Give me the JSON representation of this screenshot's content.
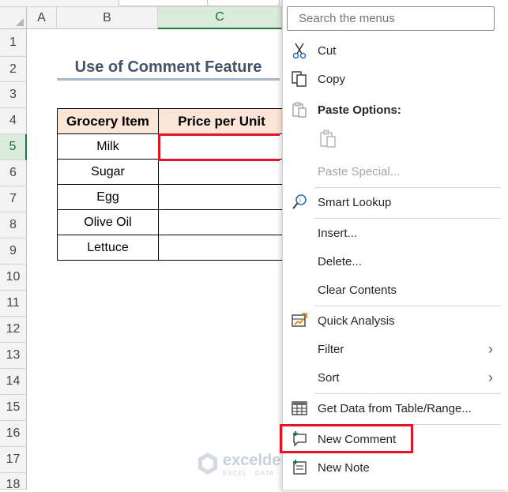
{
  "sheet": {
    "columns": [
      "A",
      "B",
      "C"
    ],
    "selected_column": "C",
    "rows": [
      "1",
      "2",
      "3",
      "4",
      "5",
      "6",
      "7",
      "8",
      "9",
      "10",
      "11",
      "12",
      "13",
      "14",
      "15",
      "16",
      "17",
      "18"
    ],
    "selected_row": "5",
    "title": "Use of Comment Feature",
    "table": {
      "headers": [
        "Grocery Item",
        "Price per Unit"
      ],
      "items": [
        "Milk",
        "Sugar",
        "Egg",
        "Olive Oil",
        "Lettuce"
      ]
    }
  },
  "watermark": {
    "name": "exceldemy",
    "sub": "EXCEL · DATA · BI"
  },
  "menu": {
    "search_placeholder": "Search the menus",
    "cut": "Cut",
    "copy": "Copy",
    "paste_options": "Paste Options:",
    "paste_special": "Paste Special...",
    "smart_lookup": "Smart Lookup",
    "insert": "Insert...",
    "delete": "Delete...",
    "clear_contents": "Clear Contents",
    "quick_analysis": "Quick Analysis",
    "filter": "Filter",
    "sort": "Sort",
    "get_data": "Get Data from Table/Range...",
    "new_comment": "New Comment",
    "new_note": "New Note"
  },
  "icons": {
    "cut": "scissors-icon",
    "copy": "copy-icon",
    "paste": "clipboard-icon",
    "smart_lookup": "magnifier-icon",
    "quick_analysis": "quick-analysis-icon",
    "get_data": "table-icon",
    "new_comment": "comment-plus-icon",
    "new_note": "note-icon"
  },
  "colors": {
    "accent_green": "#217346",
    "highlight_red": "#e81123",
    "header_fill": "#fbe5d6",
    "title_color": "#44546a"
  }
}
